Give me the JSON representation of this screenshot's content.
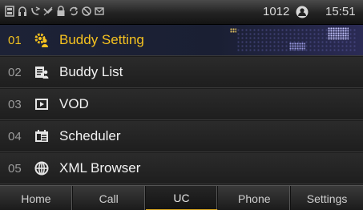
{
  "status_bar": {
    "icons": [
      "phone-book-icon",
      "headset-icon",
      "call-forward-icon",
      "missed-call-icon",
      "lock-icon",
      "sync-icon",
      "do-not-disturb-icon",
      "message-icon"
    ],
    "extension": "1012",
    "presence_icon": "user-presence-icon",
    "clock": "15:51"
  },
  "menu": {
    "items": [
      {
        "number": "01",
        "label": "Buddy Setting",
        "icon": "buddy-setting-icon",
        "selected": true
      },
      {
        "number": "02",
        "label": "Buddy List",
        "icon": "buddy-list-icon",
        "selected": false
      },
      {
        "number": "03",
        "label": "VOD",
        "icon": "vod-icon",
        "selected": false
      },
      {
        "number": "04",
        "label": "Scheduler",
        "icon": "scheduler-icon",
        "selected": false
      },
      {
        "number": "05",
        "label": "XML Browser",
        "icon": "xml-browser-icon",
        "selected": false
      }
    ]
  },
  "tabs": [
    {
      "label": "Home",
      "active": false
    },
    {
      "label": "Call",
      "active": false
    },
    {
      "label": "UC",
      "active": true
    },
    {
      "label": "Phone",
      "active": false
    },
    {
      "label": "Settings",
      "active": false
    }
  ],
  "colors": {
    "accent": "#f6c21f",
    "selected_bg": "#1d2236",
    "tab_active_underline": "#d9a520"
  }
}
